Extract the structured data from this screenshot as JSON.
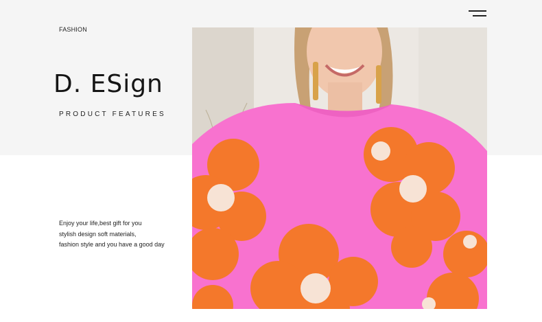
{
  "header": {
    "category": "FASHION",
    "menu_icon": "hamburger-menu-icon"
  },
  "hero": {
    "brand_title": "D. ESign",
    "subtitle": "PRODUCT FEATURES"
  },
  "description": {
    "lines": [
      "Enjoy your life,best gift for you",
      "stylish design soft materials,",
      "fashion style and you have a good day"
    ]
  },
  "product_image": {
    "subject": "woman-in-pink-sweater-with-orange-flowers",
    "colors": {
      "sweater_pink": "#f872cf",
      "flower_orange": "#f4782b",
      "flower_center": "#f7e3d5",
      "background_light": "#ece8e3"
    }
  }
}
